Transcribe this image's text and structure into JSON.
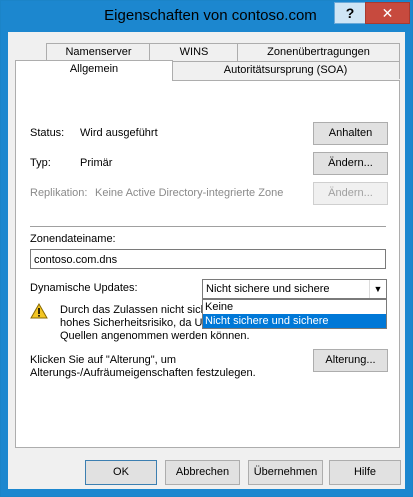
{
  "window": {
    "title": "Eigenschaften von contoso.com"
  },
  "titlebar": {
    "help_label": "?",
    "close_label": "✕"
  },
  "tabs": {
    "row1": [
      "Namenserver",
      "WINS",
      "Zonenübertragungen"
    ],
    "row2": [
      "Allgemein",
      "Autoritätsursprung (SOA)"
    ]
  },
  "status": {
    "label": "Status:",
    "value": "Wird ausgeführt",
    "button": "Anhalten"
  },
  "type": {
    "label": "Typ:",
    "value": "Primär",
    "button": "Ändern..."
  },
  "replication": {
    "label": "Replikation:",
    "value": "Keine Active Directory-integrierte Zone",
    "button": "Ändern..."
  },
  "zonefile": {
    "label": "Zonendateiname:",
    "value": "contoso.com.dns"
  },
  "dynamic_updates": {
    "label": "Dynamische Updates:",
    "selected": "Nicht sichere und sichere",
    "options": [
      "Keine",
      "Nicht sichere und sichere"
    ]
  },
  "warning": {
    "line1": "Durch das Zulassen nicht sich",
    "line2": "hohes Sicherheitsrisiko, da Up",
    "line3": "Quellen angenommen werden können."
  },
  "aging": {
    "line1": "Klicken Sie auf \"Alterung\", um",
    "line2": "Alterungs-/Aufräumeigenschaften festzulegen.",
    "button": "Alterung..."
  },
  "footer": {
    "ok": "OK",
    "cancel": "Abbrechen",
    "apply": "Übernehmen",
    "help": "Hilfe"
  }
}
